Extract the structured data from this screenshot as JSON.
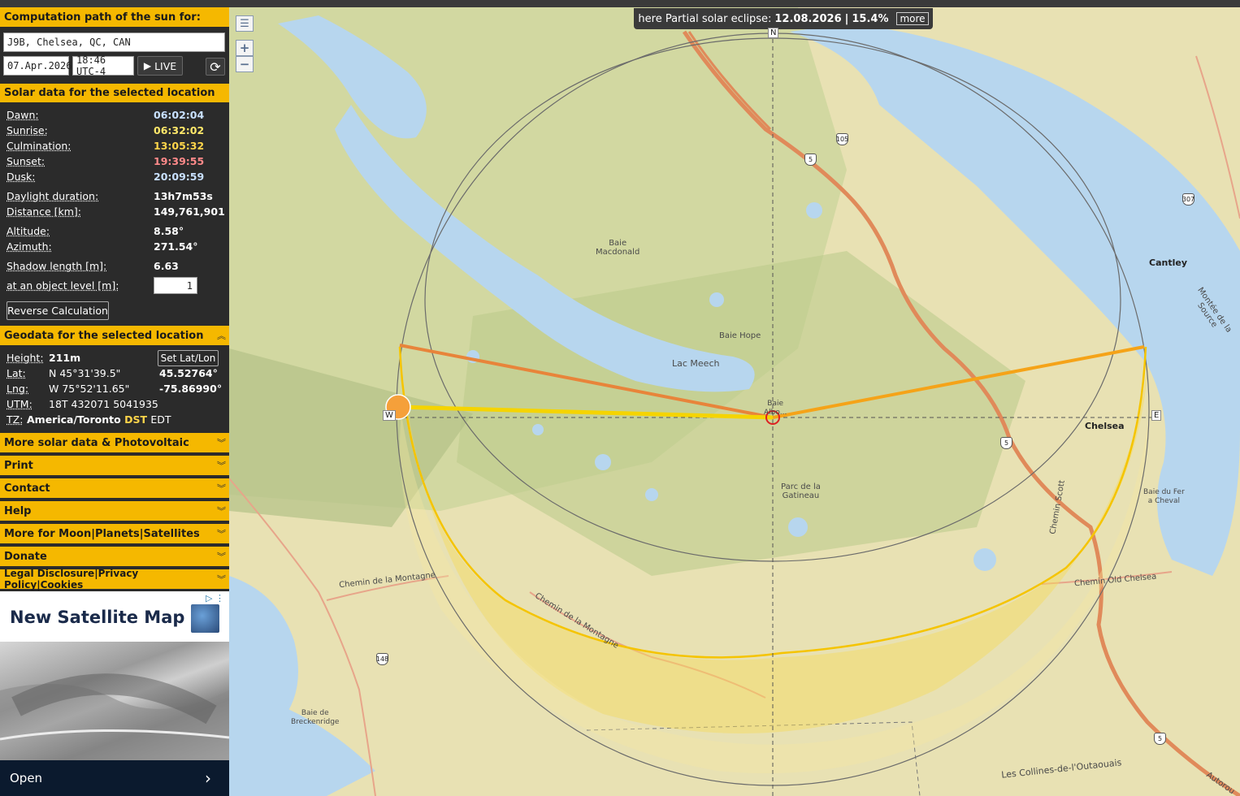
{
  "header": {
    "title": "Computation path of the sun for:",
    "location": "J9B, Chelsea, QC, CAN",
    "date": "07.Apr.2026",
    "time": "18:46 UTC-4",
    "live_label": "LIVE"
  },
  "solar": {
    "title": "Solar data for the selected location",
    "rows": [
      {
        "label": "Dawn:",
        "value": "06:02:04",
        "color": "#c8e0ff"
      },
      {
        "label": "Sunrise:",
        "value": "06:32:02",
        "color": "#ffe86a"
      },
      {
        "label": "Culmination:",
        "value": "13:05:32",
        "color": "#ffd54a"
      },
      {
        "label": "Sunset:",
        "value": "19:39:55",
        "color": "#ff8a8a"
      },
      {
        "label": "Dusk:",
        "value": "20:09:59",
        "color": "#c8e0ff"
      },
      {
        "label": "Daylight duration:",
        "value": "13h7m53s",
        "color": "#ffffff"
      },
      {
        "label": "Distance [km]:",
        "value": "149,761,901",
        "color": "#ffffff"
      },
      {
        "label": "Altitude:",
        "value": "8.58°",
        "color": "#ffffff"
      },
      {
        "label": "Azimuth:",
        "value": "271.54°",
        "color": "#ffffff"
      },
      {
        "label": "Shadow length [m]:",
        "value": "6.63",
        "color": "#ffffff"
      }
    ],
    "object_level_label": "at an object level [m]:",
    "object_level_value": "1",
    "reverse_label": "Reverse Calculation"
  },
  "geo": {
    "title": "Geodata for the selected location",
    "height_label": "Height:",
    "height_value": "211m",
    "set_latlon": "Set Lat/Lon",
    "lat_label": "Lat:",
    "lat_dms": "N 45°31'39.5\"",
    "lat_dec": "45.52764°",
    "lng_label": "Lng:",
    "lng_dms": "W 75°52'11.65\"",
    "lng_dec": "-75.86990°",
    "utm_label": "UTM:",
    "utm_value": "18T 432071 5041935",
    "tz_label": "TZ:",
    "tz_value": "America/Toronto",
    "tz_dst": "DST",
    "tz_abbr": "EDT"
  },
  "menu": [
    "More solar data & Photovoltaic",
    "Print",
    "Contact",
    "Help",
    "More for Moon|Planets|Satellites",
    "Donate",
    "Legal Disclosure|Privacy Policy|Cookies"
  ],
  "ad": {
    "title": "New Satellite Map",
    "cta": "Open"
  },
  "eclipse": {
    "prefix": "here Partial solar eclipse:",
    "date": "12.08.2026",
    "sep": "|",
    "percent": "15.4%",
    "more": "more"
  },
  "map": {
    "zoom_in": "+",
    "zoom_out": "−",
    "compass": {
      "n": "N",
      "e": "E",
      "w": "W"
    },
    "places": {
      "cantley": "Cantley",
      "chelsea": "Chelsea",
      "lac_meech": "Lac Meech",
      "baie_hope": "Baie Hope",
      "baie_macdonald": "Baie\nMacdonald",
      "parc": "Parc de la\nGatineau",
      "baie_du_fer": "Baie du Fer\na Cheval",
      "baie_breck": "Baie de\nBreckenridge",
      "chemin_montagne": "Chemin de la Montagne",
      "chemin_montagne2": "Chemin de la Montagne",
      "chemin_old": "Chemin Old Chelsea",
      "chemin_scott": "Chemin Scott",
      "collines": "Les Collines-de-l'Outaouais",
      "montee": "Montée de la Source",
      "autorou": "Autorou",
      "baie_center": "Baie\nAlbo..."
    },
    "shields": {
      "r105": "105",
      "r5a": "5",
      "r5b": "5",
      "r5c": "5",
      "r307": "307",
      "r148": "148"
    }
  }
}
